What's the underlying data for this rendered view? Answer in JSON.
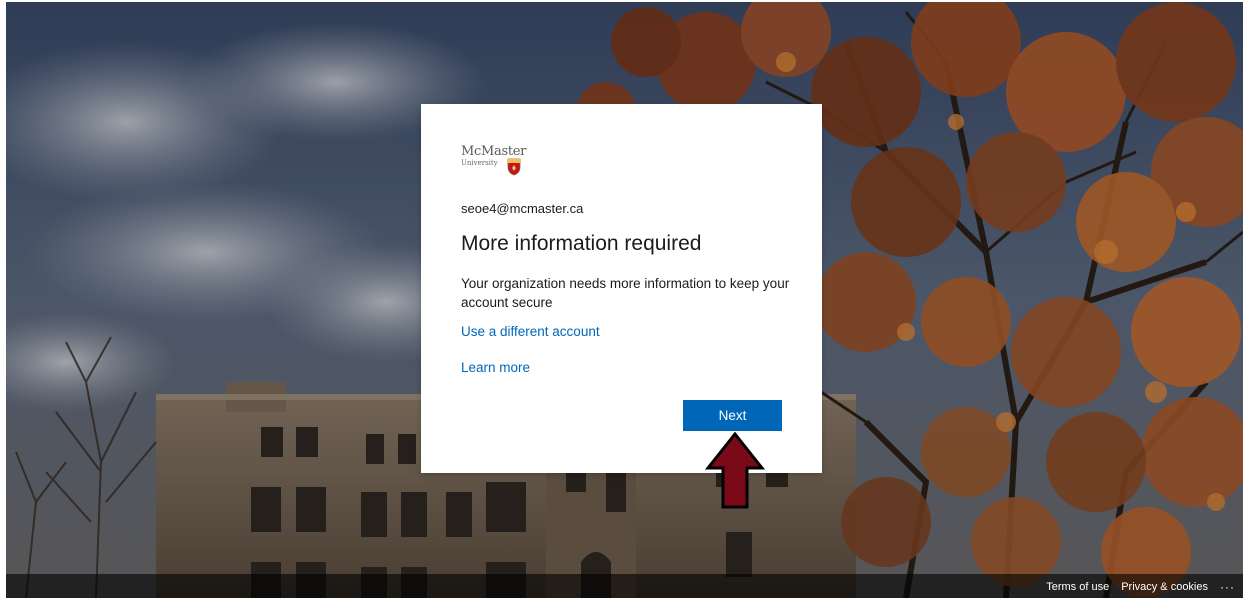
{
  "card": {
    "logo": {
      "name": "McMaster",
      "sub": "University"
    },
    "email": "seoe4@mcmaster.ca",
    "title": "More information required",
    "description": "Your organization needs more information to keep your account secure",
    "use_different_account": "Use a different account",
    "learn_more": "Learn more",
    "next_label": "Next"
  },
  "footer": {
    "terms": "Terms of use",
    "privacy": "Privacy & cookies",
    "more": "···"
  },
  "colors": {
    "accent": "#0067b8",
    "arrow": "#7a0a17",
    "crest": "#c8102e"
  },
  "icons": {
    "crest": "mcmaster-crest-icon",
    "more": "more-options-icon",
    "arrow": "arrow-up-annotation"
  }
}
